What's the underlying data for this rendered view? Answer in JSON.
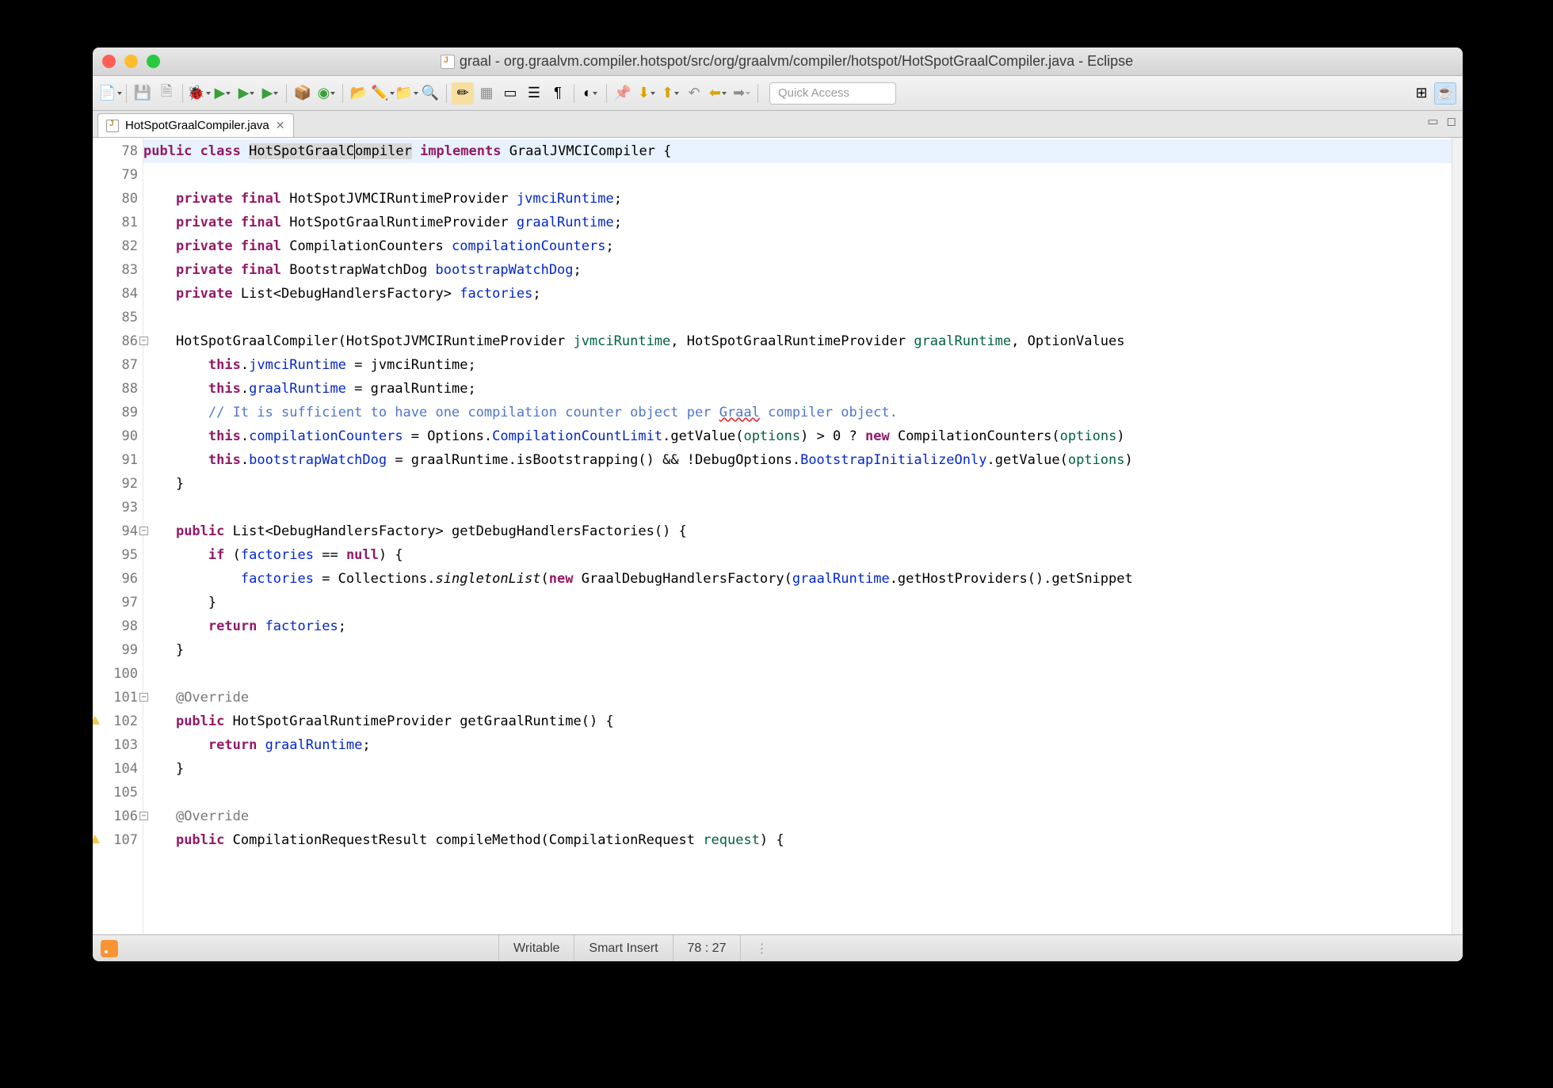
{
  "window": {
    "title": "graal - org.graalvm.compiler.hotspot/src/org/graalvm/compiler/hotspot/HotSpotGraalCompiler.java - Eclipse"
  },
  "toolbar": {
    "quick_access": "Quick Access"
  },
  "tab": {
    "label": "HotSpotGraalCompiler.java"
  },
  "status": {
    "writable": "Writable",
    "insert_mode": "Smart Insert",
    "position": "78 : 27"
  },
  "code": {
    "lines": [
      {
        "n": 78,
        "hl": true,
        "tokens": [
          [
            "kw",
            "public"
          ],
          [
            " "
          ],
          [
            "kw",
            "class"
          ],
          [
            " "
          ],
          [
            "sel",
            "HotSpotGraalC"
          ],
          [
            "caret",
            ""
          ],
          [
            "sel",
            "ompiler"
          ],
          [
            " "
          ],
          [
            "kw",
            "implements"
          ],
          [
            " "
          ],
          [
            "",
            "GraalJVMCICompiler {"
          ]
        ]
      },
      {
        "n": 79,
        "tokens": [
          [
            "",
            ""
          ]
        ]
      },
      {
        "n": 80,
        "tokens": [
          [
            "",
            "    "
          ],
          [
            "kw",
            "private"
          ],
          [
            " "
          ],
          [
            "kw",
            "final"
          ],
          [
            " "
          ],
          [
            "",
            "HotSpotJVMCIRuntimeProvider "
          ],
          [
            "fld",
            "jvmciRuntime"
          ],
          [
            "",
            ";"
          ]
        ]
      },
      {
        "n": 81,
        "tokens": [
          [
            "",
            "    "
          ],
          [
            "kw",
            "private"
          ],
          [
            " "
          ],
          [
            "kw",
            "final"
          ],
          [
            " "
          ],
          [
            "",
            "HotSpotGraalRuntimeProvider "
          ],
          [
            "fld",
            "graalRuntime"
          ],
          [
            "",
            ";"
          ]
        ]
      },
      {
        "n": 82,
        "tokens": [
          [
            "",
            "    "
          ],
          [
            "kw",
            "private"
          ],
          [
            " "
          ],
          [
            "kw",
            "final"
          ],
          [
            " "
          ],
          [
            "",
            "CompilationCounters "
          ],
          [
            "fld",
            "compilationCounters"
          ],
          [
            "",
            ";"
          ]
        ]
      },
      {
        "n": 83,
        "tokens": [
          [
            "",
            "    "
          ],
          [
            "kw",
            "private"
          ],
          [
            " "
          ],
          [
            "kw",
            "final"
          ],
          [
            " "
          ],
          [
            "",
            "BootstrapWatchDog "
          ],
          [
            "fld",
            "bootstrapWatchDog"
          ],
          [
            "",
            ";"
          ]
        ]
      },
      {
        "n": 84,
        "tokens": [
          [
            "",
            "    "
          ],
          [
            "kw",
            "private"
          ],
          [
            " "
          ],
          [
            "",
            "List<DebugHandlersFactory> "
          ],
          [
            "fld",
            "factories"
          ],
          [
            "",
            ";"
          ]
        ]
      },
      {
        "n": 85,
        "tokens": [
          [
            "",
            ""
          ]
        ]
      },
      {
        "n": 86,
        "fold": true,
        "tokens": [
          [
            "",
            "    HotSpotGraalCompiler(HotSpotJVMCIRuntimeProvider "
          ],
          [
            "str",
            "jvmciRuntime"
          ],
          [
            "",
            ", HotSpotGraalRuntimeProvider "
          ],
          [
            "str",
            "graalRuntime"
          ],
          [
            "",
            ", OptionValues"
          ]
        ]
      },
      {
        "n": 87,
        "tokens": [
          [
            "",
            "        "
          ],
          [
            "kw",
            "this"
          ],
          [
            "",
            "."
          ],
          [
            "fld",
            "jvmciRuntime"
          ],
          [
            "",
            " = jvmciRuntime;"
          ]
        ]
      },
      {
        "n": 88,
        "tokens": [
          [
            "",
            "        "
          ],
          [
            "kw",
            "this"
          ],
          [
            "",
            "."
          ],
          [
            "fld",
            "graalRuntime"
          ],
          [
            "",
            " = graalRuntime;"
          ]
        ]
      },
      {
        "n": 89,
        "tokens": [
          [
            "",
            "        "
          ],
          [
            "cmt",
            "// It is sufficient to have one compilation counter object per "
          ],
          [
            "err cmt",
            "Graal"
          ],
          [
            "cmt",
            " compiler object."
          ]
        ]
      },
      {
        "n": 90,
        "tokens": [
          [
            "",
            "        "
          ],
          [
            "kw",
            "this"
          ],
          [
            "",
            "."
          ],
          [
            "fld",
            "compilationCounters"
          ],
          [
            "",
            " = Options."
          ],
          [
            "fld",
            "CompilationCountLimit"
          ],
          [
            "i",
            ""
          ],
          [
            "",
            ".getValue("
          ],
          [
            "str",
            "options"
          ],
          [
            "",
            ") > 0 ? "
          ],
          [
            "kw",
            "new"
          ],
          [
            "",
            " CompilationCounters("
          ],
          [
            "str",
            "options"
          ],
          [
            "",
            ")"
          ]
        ]
      },
      {
        "n": 91,
        "tokens": [
          [
            "",
            "        "
          ],
          [
            "kw",
            "this"
          ],
          [
            "",
            "."
          ],
          [
            "fld",
            "bootstrapWatchDog"
          ],
          [
            "",
            " = graalRuntime.isBootstrapping() && !DebugOptions."
          ],
          [
            "fld",
            "BootstrapInitializeOnly"
          ],
          [
            "i",
            ""
          ],
          [
            "",
            ".getValue("
          ],
          [
            "str",
            "options"
          ],
          [
            "",
            ")"
          ]
        ]
      },
      {
        "n": 92,
        "tokens": [
          [
            "",
            "    }"
          ]
        ]
      },
      {
        "n": 93,
        "tokens": [
          [
            "",
            ""
          ]
        ]
      },
      {
        "n": 94,
        "fold": true,
        "tokens": [
          [
            "",
            "    "
          ],
          [
            "kw",
            "public"
          ],
          [
            " "
          ],
          [
            "",
            "List<DebugHandlersFactory> getDebugHandlersFactories() {"
          ]
        ]
      },
      {
        "n": 95,
        "tokens": [
          [
            "",
            "        "
          ],
          [
            "kw",
            "if"
          ],
          [
            "",
            " ("
          ],
          [
            "fld",
            "factories"
          ],
          [
            "",
            " == "
          ],
          [
            "kw",
            "null"
          ],
          [
            "",
            ") {"
          ]
        ]
      },
      {
        "n": 96,
        "tokens": [
          [
            "",
            "            "
          ],
          [
            "fld",
            "factories"
          ],
          [
            "",
            " = Collections."
          ],
          [
            "i",
            "singletonList"
          ],
          [
            "",
            "("
          ],
          [
            "kw",
            "new"
          ],
          [
            "",
            " GraalDebugHandlersFactory("
          ],
          [
            "fld",
            "graalRuntime"
          ],
          [
            "",
            ".getHostProviders().getSnippet"
          ]
        ]
      },
      {
        "n": 97,
        "tokens": [
          [
            "",
            "        }"
          ]
        ]
      },
      {
        "n": 98,
        "tokens": [
          [
            "",
            "        "
          ],
          [
            "kw",
            "return"
          ],
          [
            " "
          ],
          [
            "fld",
            "factories"
          ],
          [
            "",
            ";"
          ]
        ]
      },
      {
        "n": 99,
        "tokens": [
          [
            "",
            "    }"
          ]
        ]
      },
      {
        "n": 100,
        "tokens": [
          [
            "",
            ""
          ]
        ]
      },
      {
        "n": 101,
        "fold": true,
        "tokens": [
          [
            "",
            "    "
          ],
          [
            "ann",
            "@Override"
          ]
        ]
      },
      {
        "n": 102,
        "warn": true,
        "tokens": [
          [
            "",
            "    "
          ],
          [
            "kw",
            "public"
          ],
          [
            " "
          ],
          [
            "",
            "HotSpotGraalRuntimeProvider getGraalRuntime() {"
          ]
        ]
      },
      {
        "n": 103,
        "tokens": [
          [
            "",
            "        "
          ],
          [
            "kw",
            "return"
          ],
          [
            " "
          ],
          [
            "fld",
            "graalRuntime"
          ],
          [
            "",
            ";"
          ]
        ]
      },
      {
        "n": 104,
        "tokens": [
          [
            "",
            "    }"
          ]
        ]
      },
      {
        "n": 105,
        "tokens": [
          [
            "",
            ""
          ]
        ]
      },
      {
        "n": 106,
        "fold": true,
        "tokens": [
          [
            "",
            "    "
          ],
          [
            "ann",
            "@Override"
          ]
        ]
      },
      {
        "n": 107,
        "warn": true,
        "tokens": [
          [
            "",
            "    "
          ],
          [
            "kw",
            "public"
          ],
          [
            " "
          ],
          [
            "",
            "CompilationRequestResult compileMethod(CompilationRequest "
          ],
          [
            "str",
            "request"
          ],
          [
            "",
            ") {"
          ]
        ]
      }
    ]
  }
}
